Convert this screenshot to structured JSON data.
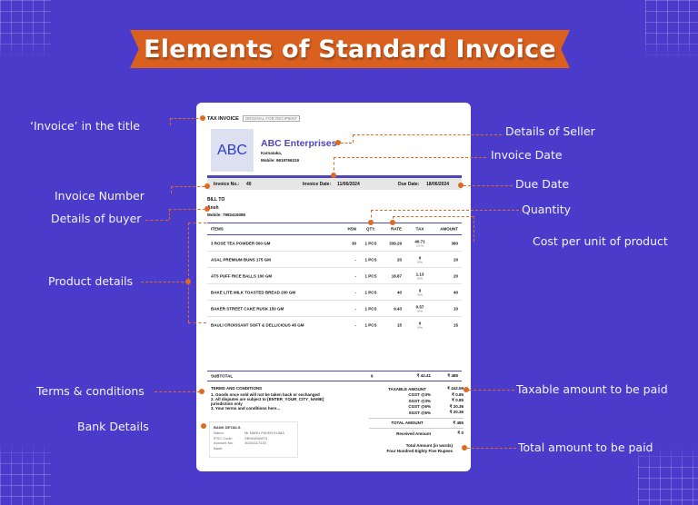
{
  "title": "Elements of Standard Invoice",
  "annotations": {
    "left": [
      {
        "id": "invoice-title",
        "text": "‘Invoice’ in the title"
      },
      {
        "id": "invoice-number",
        "text": "Invoice Number"
      },
      {
        "id": "buyer-details",
        "text": "Details of buyer"
      },
      {
        "id": "product-details",
        "text": "Product details"
      },
      {
        "id": "terms",
        "text": "Terms & conditions"
      },
      {
        "id": "bank-details",
        "text": "Bank Details"
      }
    ],
    "right": [
      {
        "id": "seller-details",
        "text": "Details of Seller"
      },
      {
        "id": "invoice-date",
        "text": "Invoice Date"
      },
      {
        "id": "due-date",
        "text": "Due Date"
      },
      {
        "id": "quantity",
        "text": "Quantity"
      },
      {
        "id": "unit-cost",
        "text": "Cost per unit of product"
      },
      {
        "id": "taxable-amount",
        "text": "Taxable amount to be paid"
      },
      {
        "id": "total-amount",
        "text": "Total amount to be paid"
      }
    ]
  },
  "colors": {
    "background": "#4b3bcb",
    "banner": "#d9601f",
    "accent": "#4f46b9",
    "connector": "#e06a1f"
  },
  "invoice": {
    "title": "TAX INVOICE",
    "badge": "ORIGINAL FOR RECIPIENT",
    "logo_text": "ABC",
    "seller": {
      "name": "ABC Enterprises",
      "address": "Karnataka,",
      "mobile": "Mobile: 9619766319"
    },
    "meta": {
      "invoice_no_label": "Invoice No.:",
      "invoice_no": "40",
      "invoice_date_label": "Invoice Date:",
      "invoice_date": "11/06/2024",
      "due_date_label": "Due Date:",
      "due_date": "18/06/2024"
    },
    "bill_to": {
      "heading": "BILL TO",
      "name": "Ansh",
      "mobile": "Mobile: 7982415086"
    },
    "columns": [
      "ITEMS",
      "HSN",
      "QTY.",
      "RATE",
      "TAX",
      "AMOUNT"
    ],
    "items": [
      {
        "name": "3 ROSE TEA POWDER 500 GM",
        "hsn": "30",
        "qty": "1 PCS",
        "rate": "339.29",
        "tax": "40.71",
        "tax_pct": "(12%)",
        "amount": "380"
      },
      {
        "name": "ASAL PREMIUM BUNS 175 GM",
        "hsn": "-",
        "qty": "1 PCS",
        "rate": "20",
        "tax": "0",
        "tax_pct": "(0%)",
        "amount": "20"
      },
      {
        "name": "ATS PUFF RICE BALLS 100 GM",
        "hsn": "-",
        "qty": "1 PCS",
        "rate": "18.87",
        "tax": "1.13",
        "tax_pct": "(6%)",
        "amount": "20"
      },
      {
        "name": "BAKE LITE MILK TOASTED BREAD 200 GM",
        "hsn": "-",
        "qty": "1 PCS",
        "rate": "40",
        "tax": "0",
        "tax_pct": "(0%)",
        "amount": "40"
      },
      {
        "name": "BAKER STREET CAKE RUSK 150 GM",
        "hsn": "-",
        "qty": "1 PCS",
        "rate": "9.43",
        "tax": "0.57",
        "tax_pct": "(6%)",
        "amount": "10"
      },
      {
        "name": "BAULI CROISSANT SOFT & DELLICIOUS 45 GM",
        "hsn": "-",
        "qty": "1 PCS",
        "rate": "15",
        "tax": "0",
        "tax_pct": "(0%)",
        "amount": "15"
      }
    ],
    "subtotal": {
      "label": "SUBTOTAL",
      "qty": "6",
      "tax": "₹ 42.41",
      "amount": "₹ 485"
    },
    "terms": {
      "heading": "TERMS AND CONDITIONS",
      "lines": [
        "1. Goods once sold will not be taken back or exchanged",
        "2. All disputes are subject to [ENTER_YOUR_CITY_NAME]",
        "jurisdiction only",
        "3. Your terms and conditions here..."
      ]
    },
    "bank": {
      "heading": "BANK DETAILS",
      "rows": [
        {
          "k": "Name:",
          "v": "Mr NARU PAVEN KUMA"
        },
        {
          "k": "IFSC Code:",
          "v": "SBIN0000873"
        },
        {
          "k": "Account No:",
          "v": "30241117130"
        },
        {
          "k": "Bank:",
          "v": ""
        }
      ]
    },
    "totals": {
      "taxable_label": "TAXABLE AMOUNT",
      "taxable": "₹ 442.59",
      "rows": [
        {
          "k": "CGST @3%",
          "v": "₹ 0.85"
        },
        {
          "k": "SGST @3%",
          "v": "₹ 0.85"
        },
        {
          "k": "CGST @6%",
          "v": "₹ 20.36"
        },
        {
          "k": "SGST @6%",
          "v": "₹ 20.36"
        }
      ],
      "total_label": "TOTAL AMOUNT",
      "total": "₹ 485",
      "received_label": "Received Amount",
      "received": "₹ 0",
      "words_label": "Total Amount (in words)",
      "words": "Four Hundred Eighty Five Rupees"
    }
  }
}
